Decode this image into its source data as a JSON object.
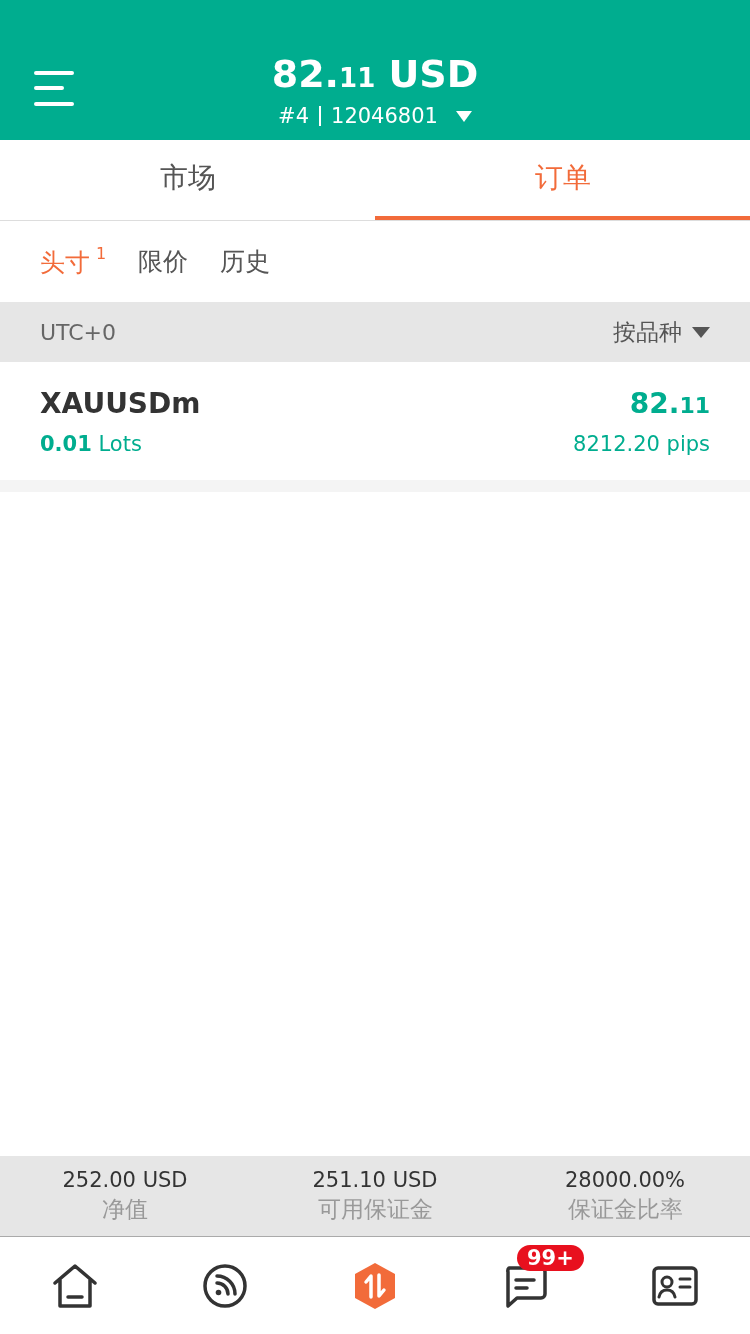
{
  "header": {
    "balance_int": "82.",
    "balance_frac": "11",
    "currency": "USD",
    "account_no": "#4",
    "account_id": "12046801"
  },
  "tabs": [
    {
      "label": "市场",
      "selected": false
    },
    {
      "label": "订单",
      "selected": true
    }
  ],
  "subtabs": [
    {
      "label": "头寸",
      "count": "1",
      "selected": true
    },
    {
      "label": "限价",
      "selected": false
    },
    {
      "label": "历史",
      "selected": false
    }
  ],
  "filter_bar": {
    "timezone": "UTC+0",
    "group_by": "按品种"
  },
  "positions": [
    {
      "symbol": "XAUUSDm",
      "volume": "0.01",
      "unit": "Lots",
      "price_int": "82.",
      "price_frac": "11",
      "pips": "8212.20 pips"
    }
  ],
  "summary": [
    {
      "value": "252.00 USD",
      "label": "净值"
    },
    {
      "value": "251.10 USD",
      "label": "可用保证金"
    },
    {
      "value": "28000.00%",
      "label": "保证金比率"
    }
  ],
  "nav": [
    {
      "kind": "home",
      "selected": false
    },
    {
      "kind": "feed",
      "selected": false
    },
    {
      "kind": "trade",
      "selected": true
    },
    {
      "kind": "chat",
      "selected": false,
      "badge": "99+"
    },
    {
      "kind": "profile",
      "selected": false
    }
  ]
}
